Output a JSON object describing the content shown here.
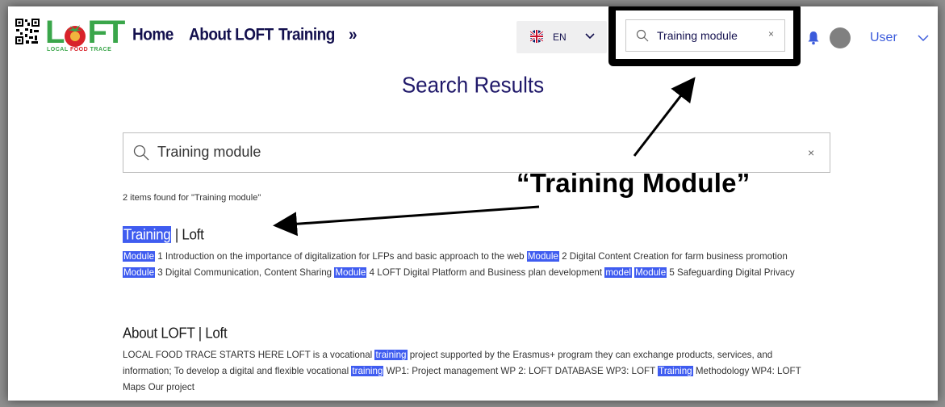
{
  "header": {
    "logo_text": "LOFT",
    "logo_subtitle": "LOCAL FOOD TRACE",
    "nav": [
      "Home",
      "About LOFT",
      "Training",
      "»"
    ],
    "language": {
      "code": "EN",
      "flag": "uk-flag-icon"
    },
    "search": {
      "value": "Training module",
      "clear": "×"
    },
    "user": "User"
  },
  "main": {
    "title": "Search Results",
    "search": {
      "value": "Training module",
      "clear": "×"
    },
    "count_text": "2 items found for \"Training module\"",
    "results": [
      {
        "title_parts": [
          "Training",
          " | Loft"
        ],
        "snippet": [
          {
            "t": "Module",
            "hl": true
          },
          {
            "t": " 1 Introduction on the importance of digitalization for LFPs and basic approach to the web ",
            "hl": false
          },
          {
            "t": "Module",
            "hl": true
          },
          {
            "t": " 2 Digital Content Creation for farm business promotion ",
            "hl": false
          },
          {
            "t": "Module",
            "hl": true
          },
          {
            "t": " 3 Digital Communication, Content Sharing ",
            "hl": false
          },
          {
            "t": "Module",
            "hl": true
          },
          {
            "t": " 4 LOFT Digital Platform and Business plan development ",
            "hl": false
          },
          {
            "t": "model",
            "hl": true
          },
          {
            "t": " ",
            "hl": false
          },
          {
            "t": "Module",
            "hl": true
          },
          {
            "t": " 5 Safeguarding Digital Privacy",
            "hl": false
          }
        ]
      },
      {
        "title_parts": [
          "",
          "About LOFT | Loft"
        ],
        "snippet": [
          {
            "t": "LOCAL FOOD TRACE STARTS HERE LOFT is a vocational ",
            "hl": false
          },
          {
            "t": "training",
            "hl": true
          },
          {
            "t": " project supported by the Erasmus+ program they can exchange products, services, and information; To develop a digital and flexible vocational ",
            "hl": false
          },
          {
            "t": "training",
            "hl": true
          },
          {
            "t": " WP1: Project management WP 2: LOFT DATABASE WP3: LOFT ",
            "hl": false
          },
          {
            "t": "Training",
            "hl": true
          },
          {
            "t": " Methodology WP4: LOFT Maps Our project",
            "hl": false
          }
        ]
      }
    ]
  },
  "annotation": {
    "callout": "“Training Module”"
  },
  "colors": {
    "nav_text": "#13104e",
    "title": "#20196a",
    "highlight": "#3f5cf0",
    "user_link": "#3b5bdb",
    "logo_green": "#3aa64a",
    "logo_red": "#d8232a"
  }
}
